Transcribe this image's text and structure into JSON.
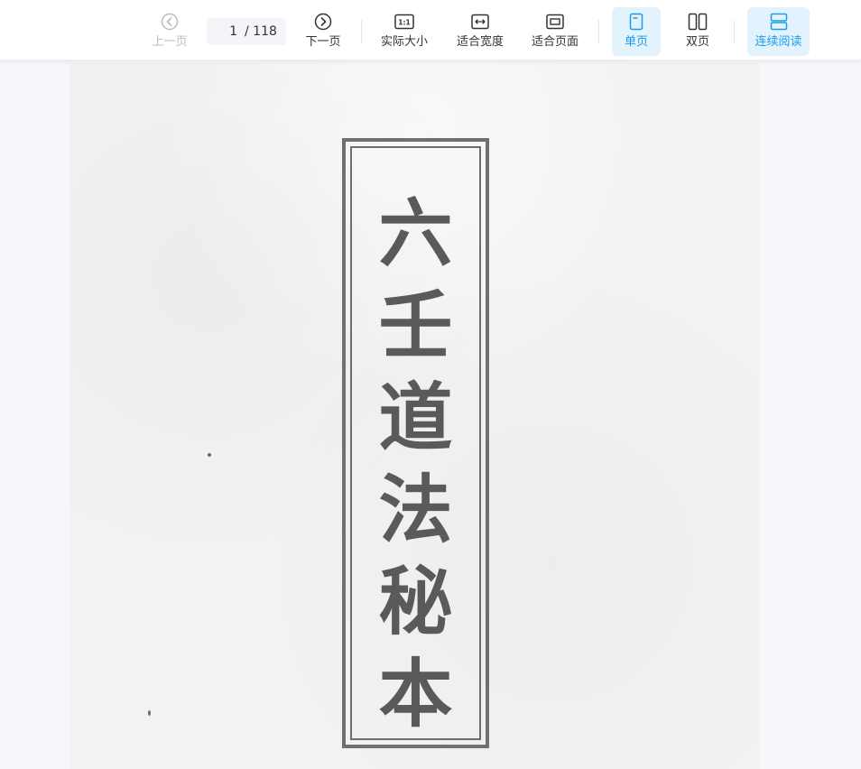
{
  "toolbar": {
    "prev_label": "上一页",
    "next_label": "下一页",
    "current_page": "1",
    "total_pages": "/ 118",
    "actual_size_label": "实际大小",
    "fit_width_label": "适合宽度",
    "fit_page_label": "适合页面",
    "single_page_label": "单页",
    "double_page_label": "双页",
    "continuous_label": "连续阅读",
    "actual_size_icon_text": "1:1"
  },
  "document": {
    "title_chars": [
      "六",
      "壬",
      "道",
      "法",
      "秘",
      "本"
    ]
  },
  "colors": {
    "accent": "#1a9ee8",
    "active_bg": "#e3f3fd",
    "disabled": "#b8bcc4"
  },
  "icons": {
    "prev": "chevron-left-circle-icon",
    "next": "chevron-right-circle-icon",
    "actual_size": "actual-size-icon",
    "fit_width": "fit-width-icon",
    "fit_page": "fit-page-icon",
    "single_page": "single-page-icon",
    "double_page": "double-page-icon",
    "continuous": "continuous-scroll-icon"
  }
}
